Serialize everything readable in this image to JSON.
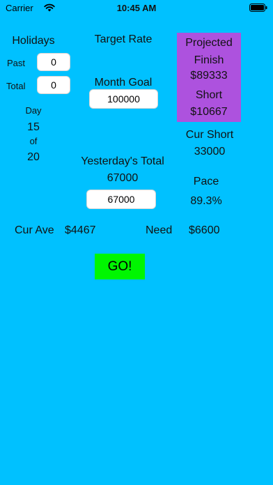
{
  "status_bar": {
    "carrier": "Carrier",
    "time": "10:45 AM",
    "wifi_icon": "wifi-icon",
    "battery_icon": "battery-icon"
  },
  "holidays": {
    "title": "Holidays",
    "past_label": "Past",
    "past_value": "0",
    "total_label": "Total",
    "total_value": "0"
  },
  "day": {
    "label": "Day",
    "current": "15",
    "of_label": "of",
    "total": "20"
  },
  "target_rate": {
    "title": "Target Rate",
    "month_goal_label": "Month Goal",
    "month_goal_value": "100000"
  },
  "projected": {
    "title": "Projected",
    "finish_label": "Finish",
    "finish_value": "$89333",
    "short_label": "Short",
    "short_value": "$10667"
  },
  "cur_short": {
    "label": "Cur Short",
    "value": "33000"
  },
  "yesterday": {
    "label": "Yesterday's Total",
    "value": "67000",
    "input_value": "67000"
  },
  "pace": {
    "label": "Pace",
    "value": "89.3%"
  },
  "summary": {
    "cur_ave_label": "Cur Ave",
    "cur_ave_value": "$4467",
    "need_label": "Need",
    "need_value": "$6600"
  },
  "go_button": {
    "label": "GO!"
  },
  "colors": {
    "background": "#00c1ff",
    "projected_box": "#ad52de",
    "go_button": "#00f600"
  }
}
